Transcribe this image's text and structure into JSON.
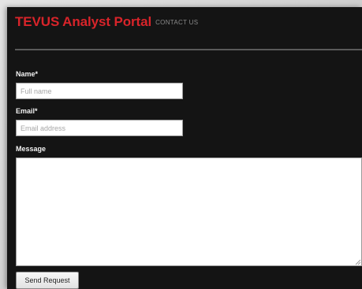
{
  "header": {
    "title": "TEVUS Analyst Portal",
    "subtitle": "CONTACT US"
  },
  "form": {
    "name": {
      "label": "Name*",
      "placeholder": "Full name",
      "value": ""
    },
    "email": {
      "label": "Email*",
      "placeholder": "Email address",
      "value": ""
    },
    "message": {
      "label": "Message",
      "value": ""
    },
    "submit_label": "Send Request"
  },
  "colors": {
    "brand": "#d8242a",
    "panel_background": "#141414"
  },
  "icons": [
    "textarea-resize-grip-icon"
  ]
}
